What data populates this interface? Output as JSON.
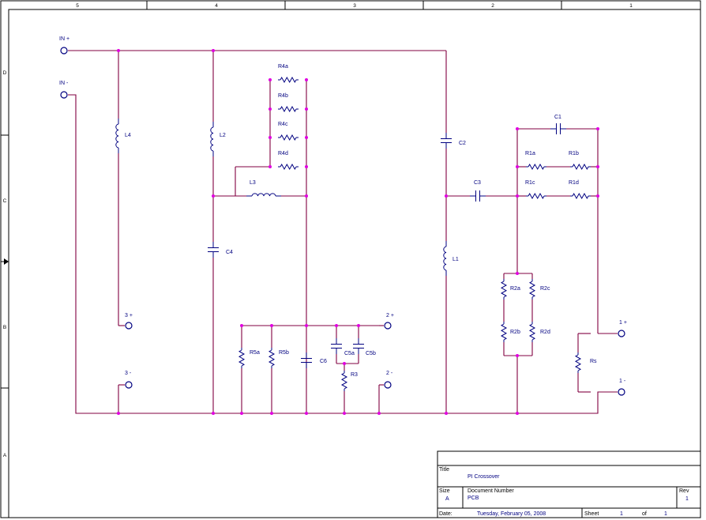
{
  "zones": {
    "columns": [
      "5",
      "4",
      "3",
      "2",
      "1"
    ],
    "rows": [
      "D",
      "C",
      "B",
      "A"
    ]
  },
  "schematic": {
    "ports": {
      "in_plus": "IN +",
      "in_minus": "IN -",
      "out3_plus": "3 +",
      "out3_minus": "3 -",
      "out2_plus": "2 +",
      "out2_minus": "2 -",
      "out1_plus": "1 +",
      "out1_minus": "1 -"
    },
    "components": {
      "L1": "L1",
      "L2": "L2",
      "L3": "L3",
      "L4": "L4",
      "C1": "C1",
      "C2": "C2",
      "C3": "C3",
      "C4": "C4",
      "C5a": "C5a",
      "C5b": "C5b",
      "C6": "C6",
      "R1a": "R1a",
      "R1b": "R1b",
      "R1c": "R1c",
      "R1d": "R1d",
      "R2a": "R2a",
      "R2b": "R2b",
      "R2c": "R2c",
      "R2d": "R2d",
      "R3": "R3",
      "R4a": "R4a",
      "R4b": "R4b",
      "R4c": "R4c",
      "R4d": "R4d",
      "R5a": "R5a",
      "R5b": "R5b",
      "Rs": "Rs"
    }
  },
  "title_block": {
    "title_label": "Title",
    "title": "PI Crossover",
    "size_label": "Size",
    "size": "A",
    "doc_number_label": "Document Number",
    "doc_number": "PCB",
    "rev_label": "Rev",
    "rev": "1",
    "date_label": "Date:",
    "date": "Tuesday, February 05, 2008",
    "sheet_label": "Sheet",
    "sheet": "1",
    "of_label": "of",
    "sheets": "1"
  },
  "colors": {
    "wire": "#800040",
    "component": "#000080",
    "junction": "#e000e0",
    "frame": "#000000"
  }
}
